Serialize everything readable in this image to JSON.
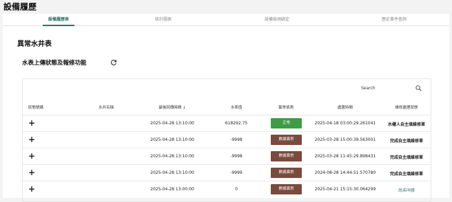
{
  "app": {
    "title": "設備履歷"
  },
  "tabs": [
    {
      "label": "設備履歷表",
      "active": true
    },
    {
      "label": "統計圖表",
      "active": false
    },
    {
      "label": "設備檢測綁定",
      "active": false
    },
    {
      "label": "歷史事件查詢",
      "active": false
    }
  ],
  "section": {
    "title": "異常水井表",
    "subtitle": "水表上傳狀態及報修功能",
    "refresh_icon": "refresh-icon"
  },
  "search": {
    "label": "Search",
    "icon": "search-icon"
  },
  "table": {
    "headers": [
      "狀態號碼",
      "水井名稱",
      "最後回傳時間 ↓",
      "水表值",
      "異常偵測",
      "處置時間",
      "維修處理狀態"
    ],
    "rows": [
      {
        "expand": "+",
        "name": "",
        "last_time": "2025-04-28 13:10:00",
        "value": "618292.75",
        "status": "正常",
        "status_color": "#3e9c45",
        "handle_time": "2025-04-18 03:00:29.261041",
        "repair": "水權人自主填維修單",
        "repair_style": "bold"
      },
      {
        "expand": "+",
        "name": "",
        "last_time": "2025-04-28 13:10:00",
        "value": "-9998",
        "status": "數據異常",
        "status_color": "#7a4a3c",
        "handle_time": "2025-03-28 15:00:39.563001",
        "repair": "完成自主填維修單",
        "repair_style": "bold"
      },
      {
        "expand": "+",
        "name": "",
        "last_time": "2025-04-28 13:10:00",
        "value": "-9998",
        "status": "數據異常",
        "status_color": "#7a4a3c",
        "handle_time": "2025-03-28 11:45:29.898431",
        "repair": "完成自主填維修單",
        "repair_style": "bold"
      },
      {
        "expand": "+",
        "name": "",
        "last_time": "2025-04-28 13:10:00",
        "value": "-9999",
        "status": "數據異常",
        "status_color": "#7a4a3c",
        "handle_time": "2024-08-28 14:44:51.570780",
        "repair": "完成自主填維修單",
        "repair_style": "bold"
      },
      {
        "expand": "+",
        "name": "",
        "last_time": "2025-04-28 13:00:00",
        "value": "0",
        "status": "數據異常",
        "status_color": "#7a4a3c",
        "handle_time": "2025-04-21 15:15:30.064299",
        "repair": "尚未叫修",
        "repair_style": "link"
      }
    ]
  }
}
